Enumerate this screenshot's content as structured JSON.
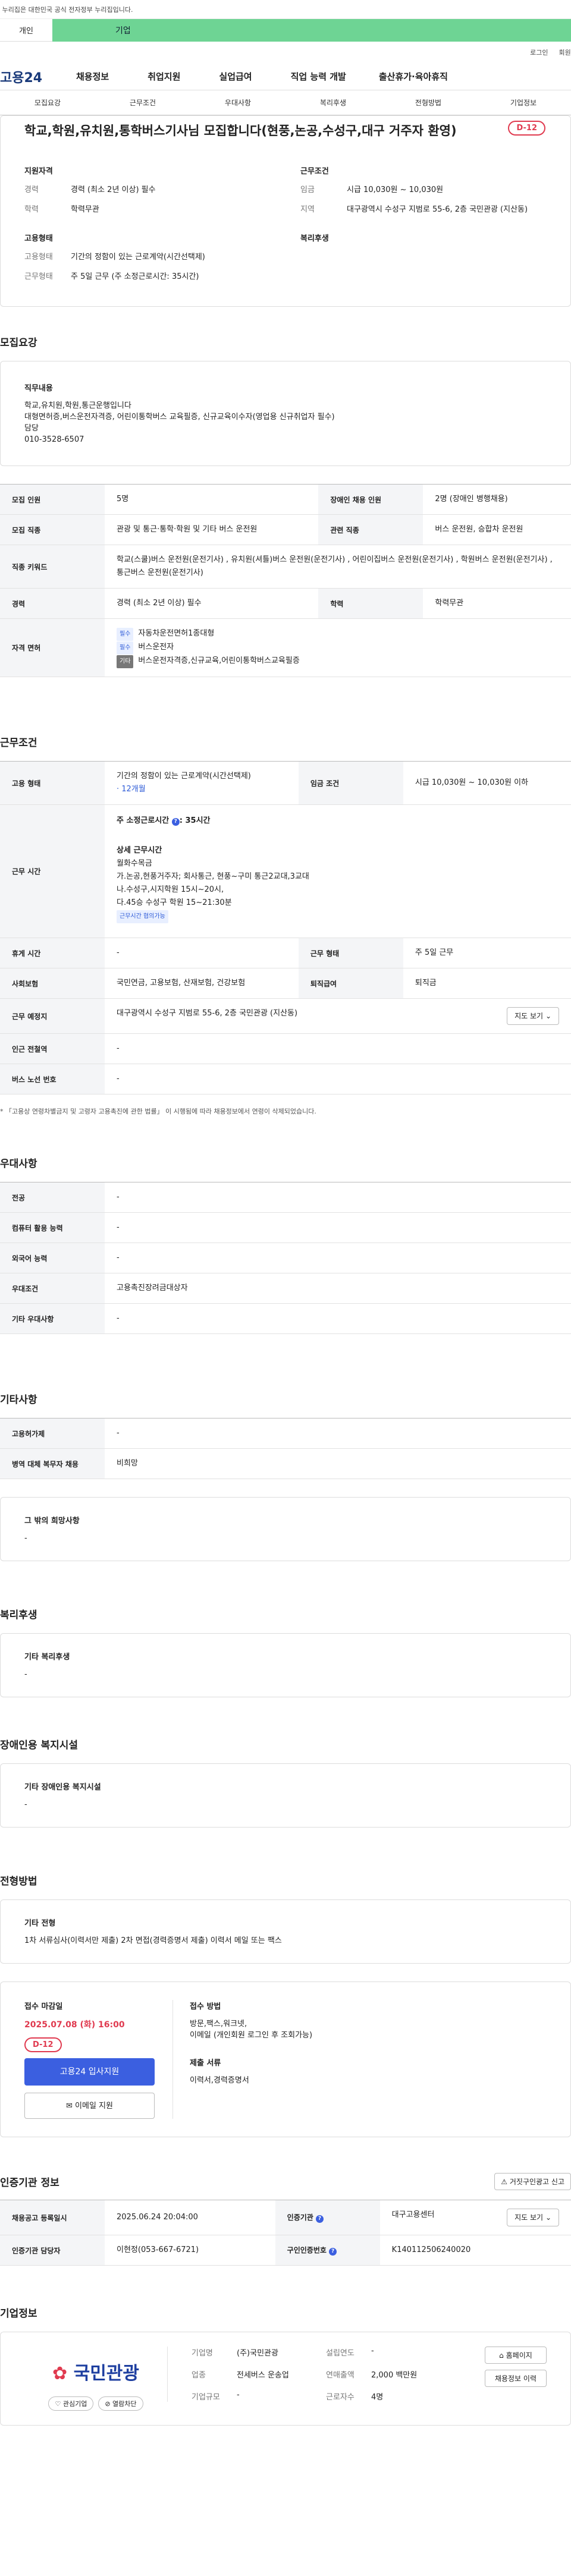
{
  "top": {
    "gov_notice": "이 누리집은 대한민국 공식 전자정부 누리집입니다.",
    "tab_individual": "개인",
    "tab_business": "기업",
    "login": "로그인",
    "signup": "회원가입"
  },
  "gnb": {
    "logo": "고용24",
    "items": [
      "채용정보",
      "취업지원",
      "실업급여",
      "직업 능력 개발",
      "출산휴가·육아휴직"
    ]
  },
  "anchor_nav": [
    "모집요강",
    "근무조건",
    "우대사항",
    "복리후생",
    "전형방법",
    "기업정보"
  ],
  "job": {
    "title": "학교,학원,유치원,통학버스기사님 모집합니다(현풍,논공,수성구,대구 거주자 환영)",
    "dday": "D-12",
    "qual_head": "지원자격",
    "career_key": "경력",
    "career_val": "경력 (최소 2년 이상) 필수",
    "edu_key": "학력",
    "edu_val": "학력무관",
    "employ_head": "고용형태",
    "employ_key": "고용형태",
    "employ_val": "기간의 정함이 있는 근로계약(시간선택제)",
    "worktype_key": "근무형태",
    "worktype_val": "주 5일 근무 (주 소정근로시간: 35시간)",
    "cond_head": "근무조건",
    "wage_key": "임금",
    "wage_val": "시급 10,030원 ~ 10,030원",
    "region_key": "지역",
    "region_val": "대구광역시 수성구 지범로 55-6, 2층 국민관광 (지산동)",
    "welfare_head": "복리후생"
  },
  "recruit": {
    "heading": "모집요강",
    "duty_title": "직무내용",
    "duty_lines": [
      "학교,유치원,학원,통근운행입니다",
      "대형면허증,버스운전자격증, 어린이통학버스 교육필증, 신규교육이수자(영업용 신규취업자 필수)",
      "담당",
      "010-3528-6507"
    ],
    "rows": {
      "count_k": "모집 인원",
      "count_v": "5명",
      "disabled_k": "장애인 채용 인원",
      "disabled_v": "2명 (장애인 병행채용)",
      "job_k": "모집 직종",
      "job_v": "관광 및 통근·통학·학원 및 기타 버스 운전원",
      "related_k": "관련 직종",
      "related_v": "버스 운전원, 승합차 운전원",
      "keyword_k": "직종 키워드",
      "keyword_v": "학교(스쿨)버스 운전원(운전기사) , 유치원(셔틀)버스 운전원(운전기사) , 어린이집버스 운전원(운전기사) , 학원버스 운전원(운전기사) , 통근버스 운전원(운전기사)",
      "career_k": "경력",
      "career_v": "경력 (최소 2년 이상) 필수",
      "edu_k": "학력",
      "edu_v": "학력무관",
      "license_k": "자격 면허",
      "license_tag1": "필수",
      "license_v1": "자동차운전면허1종대형",
      "license_tag2": "필수",
      "license_v2": "버스운전자",
      "license_tag3": "기타",
      "license_v3": "버스운전자격증,신규교육,어린이통학버스교육필증"
    }
  },
  "work": {
    "heading": "근무조건",
    "employ_k": "고용 형태",
    "employ_v": "기간의 정함이 있는 근로계약(시간선택제)",
    "employ_sub": "· 12개월",
    "wage_k": "임금 조건",
    "wage_v": "시급 10,030원 ~ 10,030원 이하",
    "hours_k": "근무 시간",
    "hours_weekly": "주 소정근로시간",
    "hours_weekly_v": ": 35시간",
    "hours_detail_title": "상세 근무시간",
    "hours_lines": [
      "월화수목금",
      "가.논공,현풍거주자; 회사통근,   현풍~구미 통근2교대,3교대",
      "나.수성구,시지학원 15시~20시,",
      "다.45승 수성구 학원 15~21:30분"
    ],
    "hours_flex": "근무시간 협의가능",
    "holiday_k": "휴게 시간",
    "holiday_v": "-",
    "worktype_k": "근무 형태",
    "worktype_v": "주 5일 근무",
    "insurance_k": "사회보험",
    "insurance_v": "국민연금, 고용보험, 산재보험, 건강보험",
    "severance_k": "퇴직급여",
    "severance_v": "퇴직금",
    "place_k": "근무 예정지",
    "place_v": "대구광역시 수성구 지범로 55-6, 2층 국민관광 (지산동)",
    "map_btn": "지도 보기",
    "station_k": "인근 전철역",
    "station_v": "-",
    "bus_k": "버스 노선 번호",
    "bus_v": "-",
    "note": "「고용상 연령차별금지 및 고령자 고용촉진에 관한 법률」 이 시행됨에 따라 채용정보에서 연령이 삭제되었습니다."
  },
  "prefer": {
    "heading": "우대사항",
    "major_k": "전공",
    "major_v": "-",
    "computer_k": "컴퓨터 활용 능력",
    "computer_v": "-",
    "lang_k": "외국어 능력",
    "lang_v": "-",
    "cond_k": "우대조건",
    "cond_v": "고용촉진장려금대상자",
    "etc_k": "기타 우대사항",
    "etc_v": "-"
  },
  "other": {
    "heading": "기타사항",
    "equip_k": "고용허가제",
    "equip_v": "-",
    "military_k": "병역 대체 복무자 채용",
    "military_v": "비희망",
    "wish_title": "그 밖의 희망사항",
    "wish_v": "-"
  },
  "welfare": {
    "heading": "복리후생",
    "title": "기타 복리후생",
    "value": "-"
  },
  "disabled": {
    "heading": "장애인용 복지시설",
    "title": "기타 장애인용 복지시설",
    "value": "-"
  },
  "selection": {
    "heading": "전형방법",
    "title": "기타 전형",
    "value": "1차 서류심사(이력서만 제출) 2차 면접(경력증명서 제출) 이력서 메일 또는 팩스"
  },
  "apply": {
    "deadline_label": "접수 마감일",
    "deadline": "2025.07.08 (화) 16:00",
    "dday": "D-12",
    "btn_apply": "고용24 입사지원",
    "btn_email": "이메일 지원",
    "method_label": "접수 방법",
    "method_v": "방문,팩스,워크넷,",
    "method_v2": "이메일 (개인회원 로그인 후 조회가능)",
    "docs_label": "제출 서류",
    "docs_v": "이력서,경력증명서"
  },
  "org": {
    "heading": "인증기관 정보",
    "report_btn": "거짓구인광고 신고",
    "reg_date_k": "채용공고 등록일시",
    "reg_date_v": "2025.06.24 20:04:00",
    "inst_k": "인증기관",
    "inst_v": "대구고용센터",
    "map_btn": "지도 보기",
    "manager_k": "인증기관 담당자",
    "manager_v": "이현정(053-667-6721)",
    "num_k": "구인인증번호",
    "num_v": "K140112506240020"
  },
  "biz": {
    "heading": "기업정보",
    "logo_text": "국민관광",
    "interest_btn": "관심기업",
    "block_btn": "열람차단",
    "name_k": "기업명",
    "name_v": "(주)국민관광",
    "year_k": "설립연도",
    "year_v": "-",
    "industry_k": "업종",
    "industry_v": "전세버스 운송업",
    "sales_k": "연매출액",
    "sales_v": "2,000 백만원",
    "size_k": "기업규모",
    "size_v": "-",
    "emp_k": "근로자수",
    "emp_v": "4명",
    "home_btn": "홈페이지",
    "jobs_btn": "채용정보 이력"
  },
  "colors": {
    "accent": "#3b5fe0",
    "dday": "#e03a4f",
    "biz_tab": "#6ed494"
  }
}
